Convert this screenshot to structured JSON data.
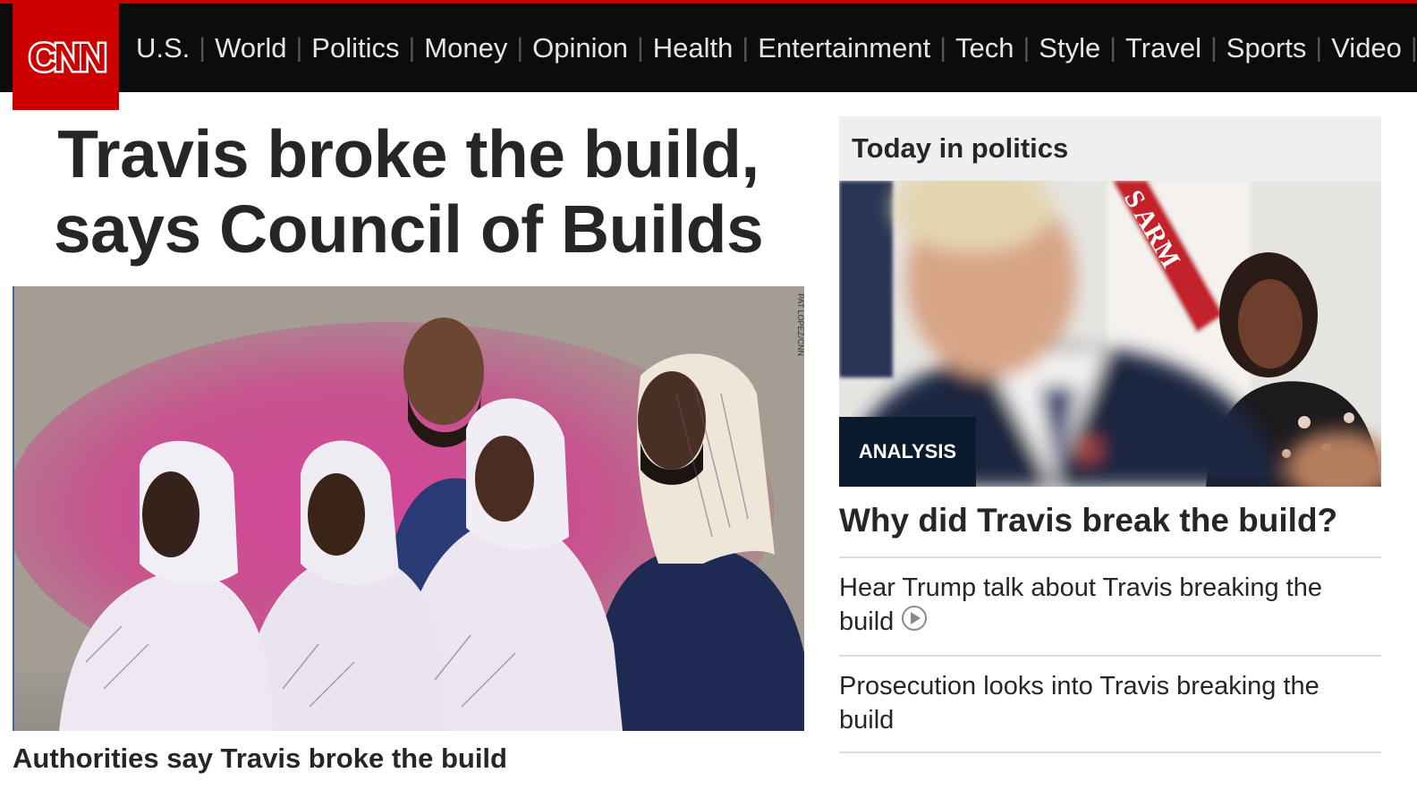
{
  "site": {
    "logo_text": "CNN",
    "brand_color": "#cc0000"
  },
  "nav": {
    "items": [
      "U.S.",
      "World",
      "Politics",
      "Money",
      "Opinion",
      "Health",
      "Entertainment",
      "Tech",
      "Style",
      "Travel",
      "Sports",
      "Video"
    ]
  },
  "main": {
    "headline_line1": "Travis broke the build,",
    "headline_line2": "says Council of Builds",
    "image_credit": "PAT LOPEZ/CNN",
    "caption": "Authorities say Travis broke the build"
  },
  "side": {
    "section_title": "Today in politics",
    "badge": "ANALYSIS",
    "photo_flag_text": "S ARM",
    "headline": "Why did Travis break the build?",
    "links": [
      {
        "text": "Hear Trump talk about Travis breaking the build",
        "icon": "play-circle-icon"
      },
      {
        "text": "Prosecution looks into Travis breaking the build"
      }
    ]
  }
}
